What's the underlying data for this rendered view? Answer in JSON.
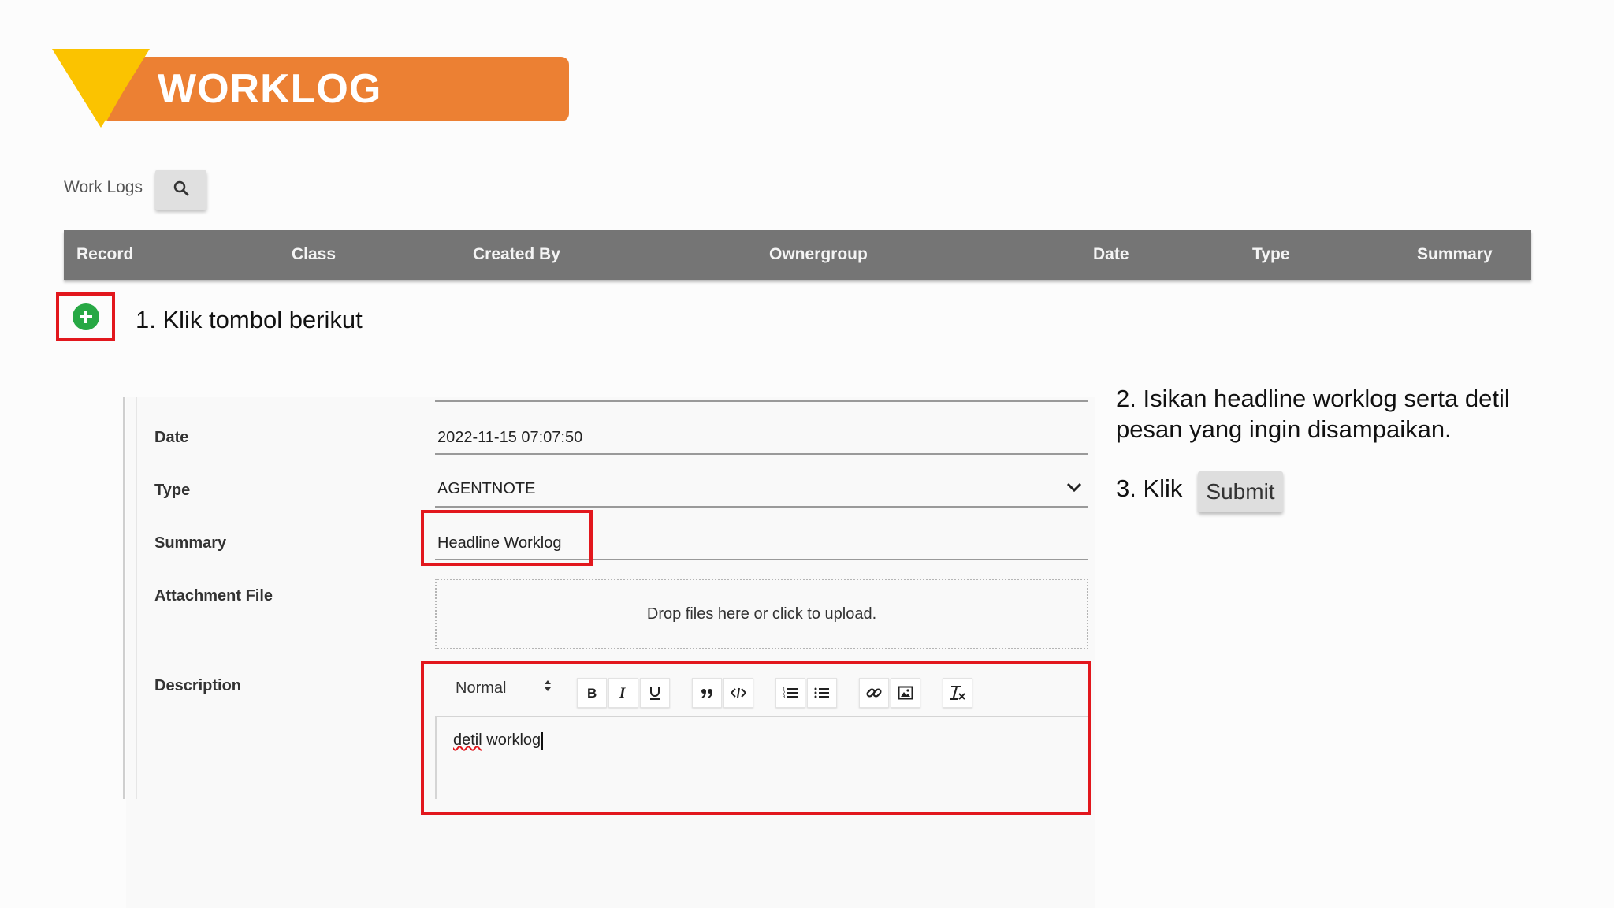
{
  "banner": {
    "title": "WORKLOG"
  },
  "worklogs": {
    "label": "Work Logs",
    "search_icon": "search-icon",
    "columns": [
      "Record",
      "Class",
      "Created By",
      "Ownergroup",
      "Date",
      "Type",
      "Summary"
    ]
  },
  "add_button": {
    "icon": "plus-circle-icon",
    "color": "#27a844"
  },
  "steps": {
    "step1": "1. Klik tombol berikut",
    "step2_line1": "2. Isikan headline worklog serta detil",
    "step2_line2": "pesan yang ingin disampaikan.",
    "step3": "3. Klik",
    "submit_label": "Submit"
  },
  "form": {
    "date_label": "Date",
    "date_value": "2022-11-15 07:07:50",
    "type_label": "Type",
    "type_value": "AGENTNOTE",
    "summary_label": "Summary",
    "summary_value": "Headline Worklog",
    "attachment_label": "Attachment File",
    "upload_text": "Drop files here or click to upload.",
    "description_label": "Description",
    "format_value": "Normal",
    "description_word1": "detil",
    "description_word2": " worklog"
  },
  "toolbar_icons": [
    "bold-icon",
    "italic-icon",
    "underline-icon",
    "blockquote-icon",
    "code-icon",
    "ordered-list-icon",
    "bullet-list-icon",
    "link-icon",
    "image-icon",
    "clear-format-icon"
  ],
  "colors": {
    "banner_orange": "#ec8033",
    "banner_yellow": "#fbc300",
    "highlight_red": "#e2171d",
    "table_header": "#757575"
  }
}
